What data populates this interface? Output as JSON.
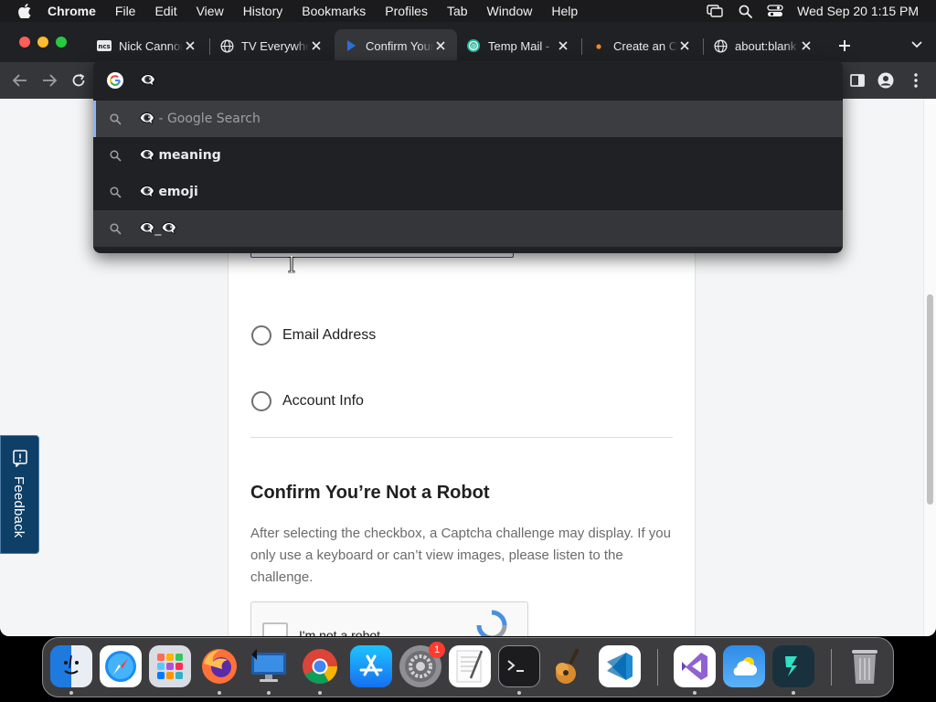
{
  "menubar": {
    "app_name": "Chrome",
    "items": [
      "File",
      "Edit",
      "View",
      "History",
      "Bookmarks",
      "Profiles",
      "Tab",
      "Window",
      "Help"
    ],
    "clock": "Wed Sep 20  1:15 PM"
  },
  "tabs": [
    {
      "title": "Nick Cannon",
      "icon": "nick-favicon"
    },
    {
      "title": "TV Everywhere",
      "icon": "globe-icon"
    },
    {
      "title": "Confirm Your",
      "icon": "play-favicon",
      "active": true
    },
    {
      "title": "Temp Mail -",
      "icon": "temp-mail-favicon"
    },
    {
      "title": "Create an O",
      "icon": "dot-favicon"
    },
    {
      "title": "about:blank",
      "icon": "globe-icon"
    }
  ],
  "omnibox": {
    "value": "👁‍🗨",
    "query_glyph": "👁‍🗨",
    "suggestions": [
      {
        "query": "👁‍🗨",
        "suffix": "- Google Search",
        "kind": "plain"
      },
      {
        "query": "👁‍🗨",
        "suffix": "meaning",
        "kind": "bold"
      },
      {
        "query": "👁‍🗨",
        "suffix": "emoji",
        "kind": "bold"
      },
      {
        "query": "👁‍🗨_👁‍🗨",
        "suffix": "",
        "kind": "plain"
      }
    ]
  },
  "page": {
    "options": [
      "Email Address",
      "Account Info"
    ],
    "robot_heading": "Confirm You’re Not a Robot",
    "robot_text": "After selecting the checkbox, a Captcha challenge may display. If you only use a keyboard or can’t view images, please listen to the challenge.",
    "captcha_label": "I'm not a robot",
    "feedback_label": "Feedback"
  },
  "dock": {
    "apps": [
      "Finder",
      "Safari",
      "Launchpad",
      "Firefox",
      "Screen Sharing",
      "Google Chrome",
      "App Store",
      "System Settings",
      "TextEdit",
      "Terminal",
      "GarageBand",
      "Visual Studio Code",
      "Visual Studio",
      "Weather",
      "Filmora",
      "Trash"
    ],
    "settings_badge": "1"
  },
  "colors": {
    "tabstrip": "#202124",
    "active_tab": "#35363a",
    "omnibox_bg": "#202124",
    "selected_suggestion": "#3c3d41",
    "accent": "#8ab4f8",
    "feedback_bg": "#0e3f67"
  }
}
